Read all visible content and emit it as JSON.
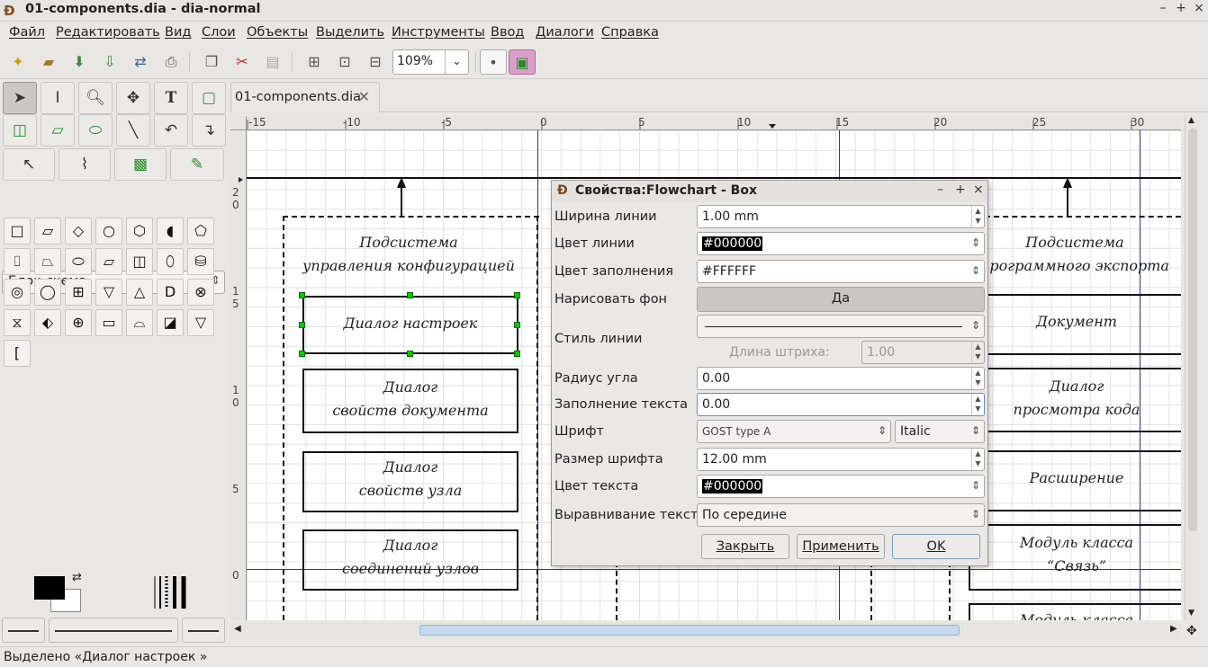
{
  "window": {
    "title": "01-components.dia - dia-normal",
    "app_icon": "dia-icon"
  },
  "menu": [
    "Файл",
    "Редактировать",
    "Вид",
    "Слои",
    "Объекты",
    "Выделить",
    "Инструменты",
    "Ввод",
    "Диалоги",
    "Справка"
  ],
  "toolbar": {
    "zoom": "109%"
  },
  "toolbox": {
    "sheet": "Блок-схема"
  },
  "tabs": [
    {
      "label": "01-components.dia"
    }
  ],
  "ruler": {
    "h": [
      "-15",
      "-10",
      "-5",
      "0",
      "5",
      "10",
      "15",
      "20",
      "25",
      "30"
    ],
    "v": [
      "2",
      "0",
      "1",
      "5",
      "1",
      "0",
      "5",
      "0"
    ]
  },
  "diagram": {
    "left_group": [
      "Подсистема",
      "управления конфигурацией"
    ],
    "right_group": [
      "Подсистема",
      "программного экспорта"
    ],
    "boxes_left": [
      [
        "Диалог настроек"
      ],
      [
        "Диалог",
        "свойств документа"
      ],
      [
        "Диалог",
        "свойств узла"
      ],
      [
        "Диалог",
        "соединений узлов"
      ]
    ],
    "boxes_right": [
      [
        "Документ"
      ],
      [
        "Диалог",
        "просмотра кода"
      ],
      [
        "Расширение"
      ],
      [
        "Модуль класса",
        "“Связь”"
      ],
      [
        "Модуль класса"
      ]
    ]
  },
  "dialog": {
    "title": "Свойства:Flowchart - Box",
    "rows": {
      "line_width": {
        "label": "Ширина линии",
        "value": "1.00 mm"
      },
      "line_color": {
        "label": "Цвет линии",
        "value": "#000000"
      },
      "fill_color": {
        "label": "Цвет заполнения",
        "value": "#FFFFFF"
      },
      "draw_bg": {
        "label": "Нарисовать фон",
        "value": "Да"
      },
      "line_style": {
        "label": "Стиль линии",
        "dash_label": "Длина штриха:",
        "dash_value": "1.00"
      },
      "corner_radius": {
        "label": "Радиус угла",
        "value": "0.00"
      },
      "text_padding": {
        "label": "Заполнение текста",
        "value": "0.00"
      },
      "font": {
        "label": "Шрифт",
        "family": "GOST type A",
        "style": "Italic"
      },
      "font_size": {
        "label": "Размер шрифта",
        "value": "12.00 mm"
      },
      "text_color": {
        "label": "Цвет текста",
        "value": "#000000"
      },
      "text_align": {
        "label": "Выравнивание текста",
        "value": "По середине"
      }
    },
    "buttons": {
      "close": "Закрыть",
      "apply": "Применить",
      "ok": "OK"
    }
  },
  "status": "Выделено «Диалог настроек »"
}
